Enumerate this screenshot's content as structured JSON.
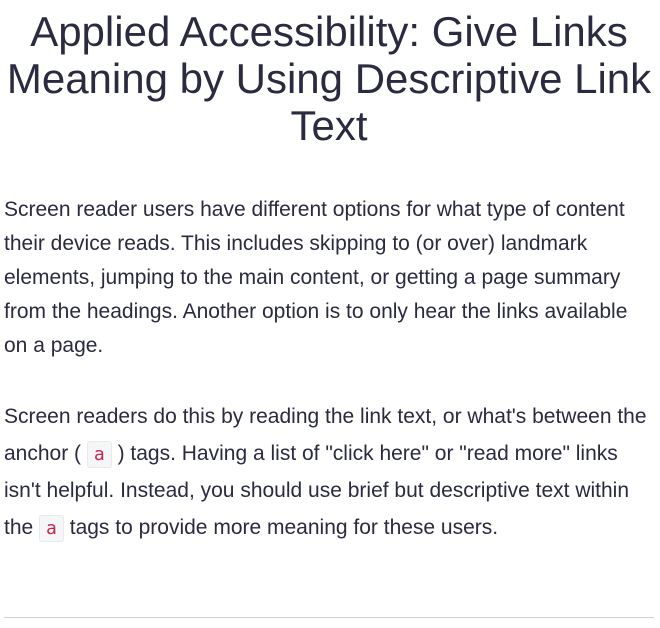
{
  "challenge": {
    "title": "Applied Accessibility: Give Links Meaning by Using Descriptive Link Text"
  },
  "description": {
    "paragraph1": "Screen reader users have different options for what type of content their device reads. This includes skipping to (or over) landmark elements, jumping to the main content, or getting a page summary from the headings. Another option is to only hear the links available on a page.",
    "paragraph2": {
      "part1": "Screen readers do this by reading the link text, or what's between the anchor (",
      "code1": "a",
      "part2": ") tags. Having a list of \"click here\" or \"read more\" links isn't helpful. Instead, you should use brief but descriptive text within the",
      "code2": "a",
      "part3": "tags to provide more meaning for these users."
    }
  }
}
